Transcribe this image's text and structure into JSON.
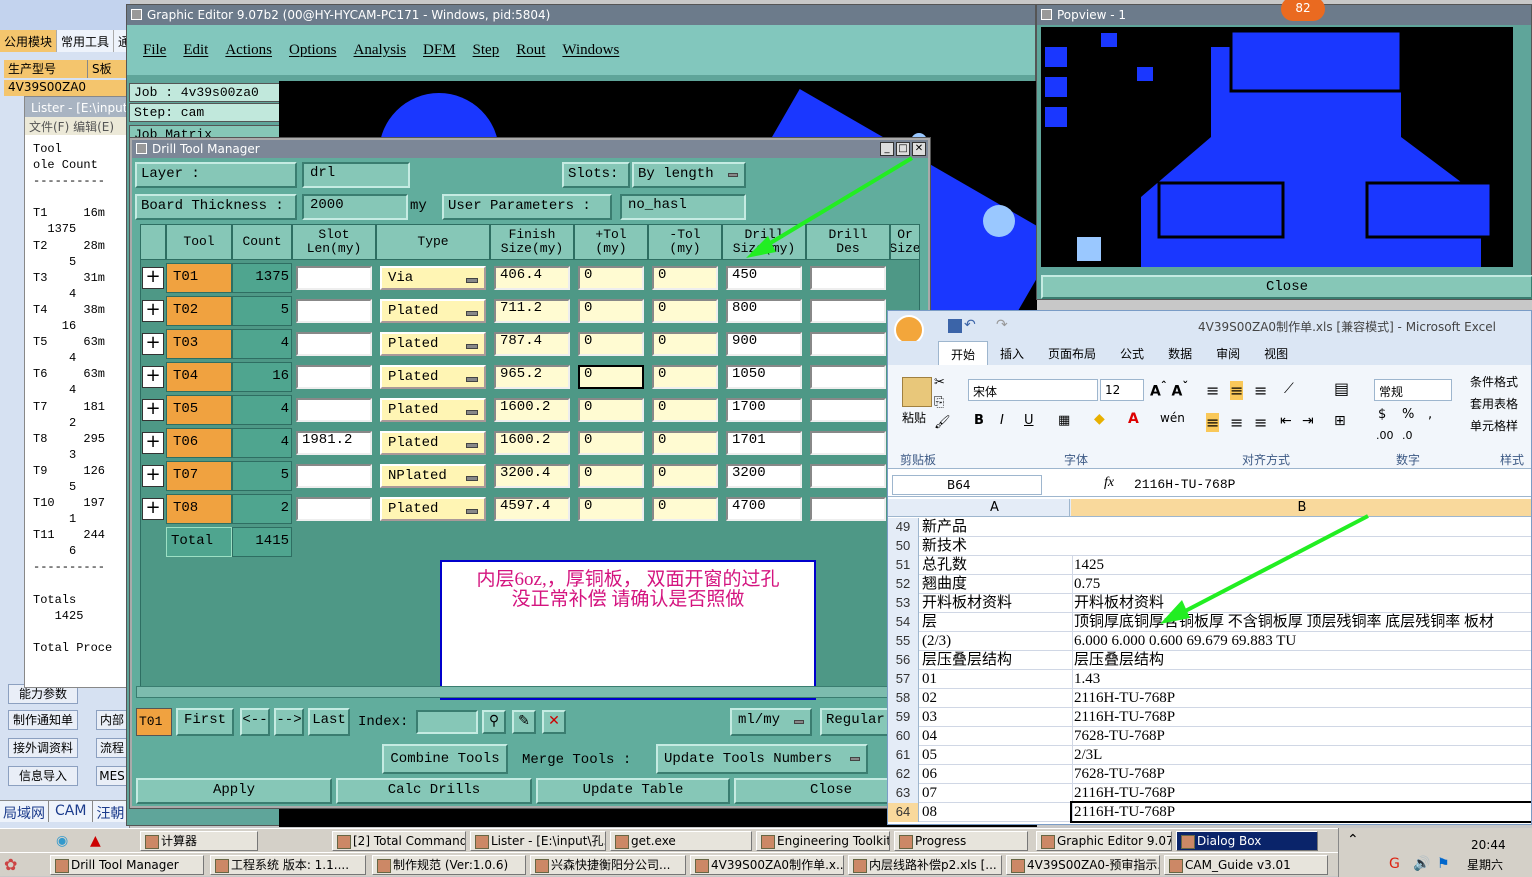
{
  "left_app": {
    "tabs": [
      "公用模块",
      "常用工具",
      "通"
    ],
    "row1": [
      "生产型号",
      "S板"
    ],
    "row2": "4V39S00ZA0",
    "side_buttons": [
      "能力参数",
      "制作通知单",
      "内部",
      "接外调资料",
      "流程",
      "信息导入",
      "MES"
    ],
    "bottom_tabs": [
      "局域网",
      "CAM",
      "汪朝"
    ]
  },
  "lister": {
    "title": "Lister - [E:\\input\\孔...",
    "menu": "文件(F)   编辑(E)",
    "content": "Tool       \nole Count \n----------\n\nT1     16m\n  1375\nT2     28m\n     5\nT3     31m\n     4\nT4     38m\n    16\nT5     63m\n     4\nT6     63m\n     4\nT7     181\n     2\nT8     295\n     3\nT9     126\n     5\nT10    197\n     1\nT11    244\n     6\n----------\n\nTotals\n   1425\n\nTotal Proce"
  },
  "graphic_editor": {
    "title": "Graphic Editor 9.07b2 (00@HY-HYCAM-PC171 - Windows, pid:5804)",
    "menu": [
      "File",
      "Edit",
      "Actions",
      "Options",
      "Analysis",
      "DFM",
      "Step",
      "Rout",
      "Windows"
    ],
    "job": "Job : 4v39s00za0",
    "step": "Step: cam",
    "matrix": "Job Matrix"
  },
  "drill_tool_manager": {
    "title": "Drill Tool Manager",
    "layer_label": "Layer       :",
    "layer_value": "drl",
    "slots_label": "Slots:",
    "slots_value": "By length",
    "board_label": "Board Thickness :",
    "board_value": "2000",
    "board_unit": "my",
    "user_params_label": "User Parameters :",
    "user_params_value": "no_hasl",
    "headers": [
      "Tool",
      "Count",
      "Slot\nLen(my)",
      "Type",
      "Finish\nSize(my)",
      "+Tol\n(my)",
      "-Tol\n(my)",
      "Drill\nSize(my)",
      "Drill\nDes",
      "Or\nSize"
    ],
    "rows": [
      {
        "tool": "T01",
        "count": "1375",
        "slot": "",
        "type": "Via",
        "finish": "406.4",
        "ptol": "0",
        "ntol": "0",
        "drill": "450"
      },
      {
        "tool": "T02",
        "count": "5",
        "slot": "",
        "type": "Plated",
        "finish": "711.2",
        "ptol": "0",
        "ntol": "0",
        "drill": "800"
      },
      {
        "tool": "T03",
        "count": "4",
        "slot": "",
        "type": "Plated",
        "finish": "787.4",
        "ptol": "0",
        "ntol": "0",
        "drill": "900"
      },
      {
        "tool": "T04",
        "count": "16",
        "slot": "",
        "type": "Plated",
        "finish": "965.2",
        "ptol": "0",
        "ntol": "0",
        "drill": "1050"
      },
      {
        "tool": "T05",
        "count": "4",
        "slot": "",
        "type": "Plated",
        "finish": "1600.2",
        "ptol": "0",
        "ntol": "0",
        "drill": "1700"
      },
      {
        "tool": "T06",
        "count": "4",
        "slot": "1981.2",
        "type": "Plated",
        "finish": "1600.2",
        "ptol": "0",
        "ntol": "0",
        "drill": "1701"
      },
      {
        "tool": "T07",
        "count": "5",
        "slot": "",
        "type": "NPlated",
        "finish": "3200.4",
        "ptol": "0",
        "ntol": "0",
        "drill": "3200"
      },
      {
        "tool": "T08",
        "count": "2",
        "slot": "",
        "type": "Plated",
        "finish": "4597.4",
        "ptol": "0",
        "ntol": "0",
        "drill": "4700"
      }
    ],
    "total_label": "Total",
    "total_count": "1415",
    "note_line1": "内层6oz,，厚铜板，   双面开窗的过孔",
    "note_line2": "没正常补偿   请确认是否照做",
    "nav_tool": "T01",
    "nav_buttons": [
      "First",
      "<--",
      "-->",
      "Last"
    ],
    "index_label": "Index:",
    "units": "ml/my",
    "regular": "Regular",
    "combine": "Combine Tools",
    "merge": "Merge Tools :",
    "update_numbers": "Update Tools Numbers",
    "bottom_buttons": [
      "Apply",
      "Calc Drills",
      "Update Table",
      "Close"
    ]
  },
  "popview": {
    "title": "Popview - 1",
    "close": "Close",
    "badge": "82"
  },
  "excel": {
    "title": "4V39S00ZA0制作单.xls  [兼容模式] - Microsoft Excel",
    "ribbon_tabs": [
      "开始",
      "插入",
      "页面布局",
      "公式",
      "数据",
      "审阅",
      "视图"
    ],
    "font_name": "宋体",
    "font_size": "12",
    "number_format": "常规",
    "groups": [
      "剪贴板",
      "字体",
      "对齐方式",
      "数字",
      "样式"
    ],
    "paste": "粘贴",
    "styles": [
      "条件格式",
      "套用表格",
      "单元格样"
    ],
    "name_box": "B64",
    "formula": "2116H-TU-768P",
    "col_a": "A",
    "col_b": "B",
    "rows": [
      {
        "n": "49",
        "a": "新产品",
        "b": ""
      },
      {
        "n": "50",
        "a": "新技术",
        "b": ""
      },
      {
        "n": "51",
        "a": "总孔数",
        "b": "1425"
      },
      {
        "n": "52",
        "a": "翘曲度",
        "b": "0.75"
      },
      {
        "n": "53",
        "a": "开料板材资料",
        "b": "开料板材资料"
      },
      {
        "n": "54",
        "a": "层",
        "b": "顶铜厚底铜厚含铜板厚 不含铜板厚 顶层残铜率 底层残铜率 板材"
      },
      {
        "n": "55",
        "a": "(2/3)",
        "b": "6.000  6.000          0.600        69.679     69.883      TU"
      },
      {
        "n": "56",
        "a": "层压叠层结构",
        "b": "层压叠层结构"
      },
      {
        "n": "57",
        "a": "01",
        "b": "1.43"
      },
      {
        "n": "58",
        "a": "02",
        "b": "2116H-TU-768P"
      },
      {
        "n": "59",
        "a": "03",
        "b": "2116H-TU-768P"
      },
      {
        "n": "60",
        "a": "04",
        "b": "7628-TU-768P"
      },
      {
        "n": "61",
        "a": "05",
        "b": "2/3L"
      },
      {
        "n": "62",
        "a": "06",
        "b": "7628-TU-768P"
      },
      {
        "n": "63",
        "a": "07",
        "b": "2116H-TU-768P"
      },
      {
        "n": "64",
        "a": "08",
        "b": "2116H-TU-768P"
      }
    ]
  },
  "taskbar": {
    "row1": [
      "计算器",
      "[2] Total Commander...",
      "Lister - [E:\\input\\孔...",
      "get.exe",
      "Engineering Toolkit 9...",
      "Progress",
      "Graphic Editor 9.07b...",
      "Dialog Box"
    ],
    "row2": [
      "Drill Tool Manager",
      "工程系统  版本: 1.1....",
      "制作规范 (Ver:1.0.6)",
      "兴森快捷衡阳分公司...",
      "4V39S00ZA0制作单.x...",
      "内层线路补偿p2.xls  [...",
      "4V39S00ZA0-预审指示...",
      "CAM_Guide v3.01"
    ],
    "time": "20:44",
    "day": "星期六"
  },
  "colors": {
    "dialog_bg": "#61ad9d",
    "tool_cell": "#f0a240",
    "yellow_field": "#fffbd2",
    "pcb_blue": "#1a37ff",
    "note_text": "#d4147f",
    "arrow": "#22ee22"
  }
}
